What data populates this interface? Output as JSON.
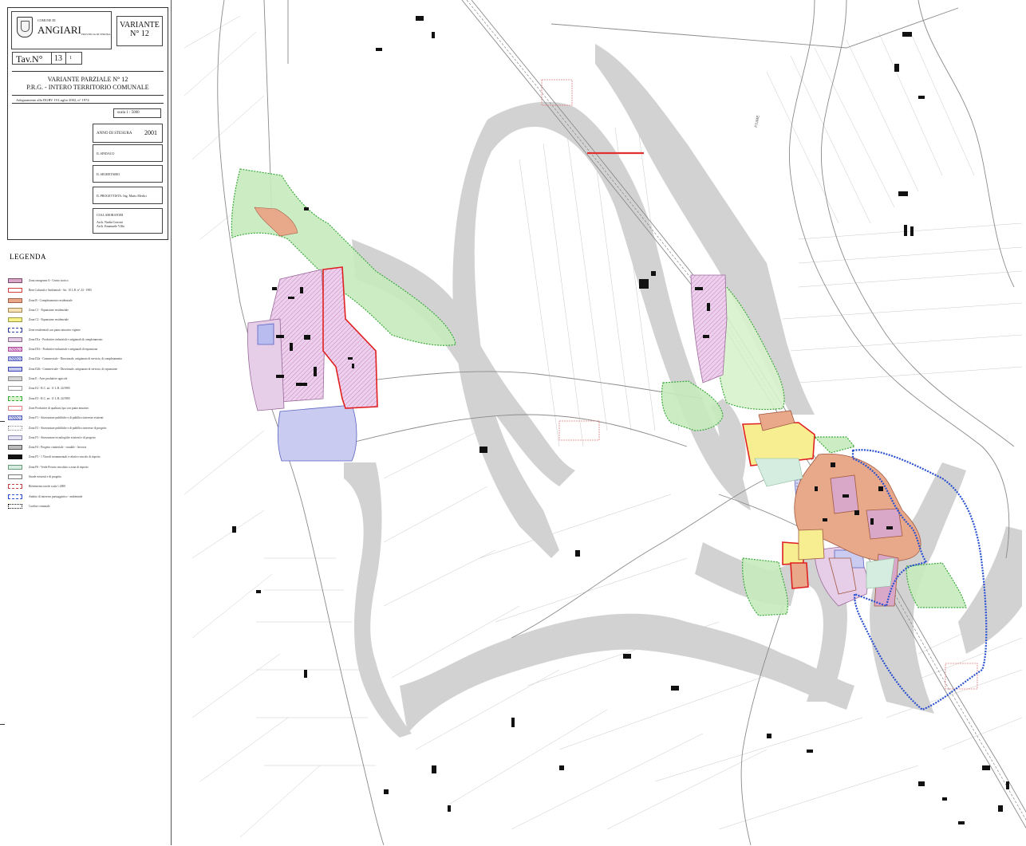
{
  "header": {
    "comune_small": "COMUNE DI",
    "comune_name": "ANGIARI",
    "provincia": "PROVINCIA DI VERONA",
    "variante_line1": "VARIANTE",
    "variante_line2": "N° 12",
    "tav_label": "Tav.N°",
    "tav_number": "13",
    "tav_sub": "1"
  },
  "title_block": {
    "line1": "VARIANTE PARZIALE N° 12",
    "line2": "P.R.G. - INTERO TERRITORIO COMUNALE",
    "line3": "Adeguamento alla DGRV 19 Luglio 2002, n° 1974",
    "scale": "scala 1 : 5000"
  },
  "signatures": {
    "anno_label": "ANNO DI STESURA",
    "anno_value": "2001",
    "sindaco": "IL SINDACO",
    "segretario": "IL SEGRETARIO",
    "progettista": "IL PROGETTISTA: Ing. Mario Medici",
    "collaboratori": "COLLABORATORI",
    "collab1": "Arch. Nadia Cerroni",
    "collab2": "Arch. Emanuele Villa"
  },
  "legend": {
    "title": "LEGENDA",
    "items": [
      {
        "label": "Zona omogenea A - Centro storico",
        "color": "#d9a7c7",
        "border": "#7a4a6a",
        "pattern": "solid"
      },
      {
        "label": "Beni Culturali e Ambientali - Art. 10 L.R. n° 24 - 1985",
        "color": "#ffffff",
        "border": "#d04040",
        "pattern": "solid"
      },
      {
        "label": "Zona B - Completamento residenziale",
        "color": "#eaa88a",
        "border": "#a0604a",
        "pattern": "solid"
      },
      {
        "label": "Zona C1 - Espansione residenziale",
        "color": "#f7e2b6",
        "border": "#a08850",
        "pattern": "solid"
      },
      {
        "label": "Zona C2 - Espansione residenziale",
        "color": "#f7f28a",
        "border": "#999944",
        "pattern": "solid"
      },
      {
        "label": "Zone residenziali con piano attuativo vigente",
        "color": "#ffffff",
        "border": "#2a3a9a",
        "pattern": "dashed"
      },
      {
        "label": "Zona D1a - Produttive industriali e artigianali di completamento",
        "color": "#e6cfe6",
        "border": "#8a6a8a",
        "pattern": "solid"
      },
      {
        "label": "Zona D1b - Produttive industriali e artigianali di espansione",
        "color": "#ecc6e6",
        "border": "#b04a9a",
        "pattern": "hatch"
      },
      {
        "label": "Zona D2a - Commerciale - Direzionale, artigianato di servizio, di completamento",
        "color": "#c9cdf0",
        "border": "#5a64c0",
        "pattern": "hatch"
      },
      {
        "label": "Zona D2b - Commerciale - Direzionale, artigianato di servizio, di espansione",
        "color": "#c6c9ee",
        "border": "#3a44b0",
        "pattern": "solid"
      },
      {
        "label": "Zona E - Aree produttive agricole",
        "color": "#d6d6d6",
        "border": "#888888",
        "pattern": "solid"
      },
      {
        "label": "Zona E2 - R.C. art. 11 L.R. 24/1985",
        "color": "#ffffff",
        "border": "#999999",
        "pattern": "solid"
      },
      {
        "label": "Zona E3 - R.C. art. 11 L.R. 24/1985",
        "color": "#d8f2cc",
        "border": "#3aaa3a",
        "pattern": "dashed"
      },
      {
        "label": "Zone Produttive di qualsiasi tipo con piano attuativo",
        "color": "#ffffff",
        "border": "#e08080",
        "pattern": "solid"
      },
      {
        "label": "Zona F1 - Attrezzature pubbliche e di pubblico interesse esistenti",
        "color": "#d9dcf2",
        "border": "#5a64c0",
        "pattern": "hatch"
      },
      {
        "label": "Zona F2 - Attrezzature pubbliche e di pubblico interesse di progetto",
        "color": "#ffffff",
        "border": "#888888",
        "pattern": "dots"
      },
      {
        "label": "Zona F3 - Attrezzature tecnologiche esistenti e di progetto",
        "color": "#e6e4f4",
        "border": "#8888aa",
        "pattern": "solid"
      },
      {
        "label": "Zona F4 - Progetto cimiteriale - stradale - ferrovia",
        "color": "#bdbdbd",
        "border": "#555555",
        "pattern": "solid"
      },
      {
        "label": "Zona F5 - 1 Vincoli monumentali e relativo vincolo di rispetto",
        "color": "#111111",
        "border": "#111111",
        "pattern": "solid"
      },
      {
        "label": "Zona F6 - Verde Privato vincolato a zona di rispetto",
        "color": "#d5ede0",
        "border": "#6a9a7a",
        "pattern": "solid"
      },
      {
        "label": "Strade esistenti e di progetto",
        "color": "#ffffff",
        "border": "#777777",
        "pattern": "solid"
      },
      {
        "label": "Riferimento tavole scala 1:2000",
        "color": "#ffffff",
        "border": "#c04040",
        "pattern": "dashed"
      },
      {
        "label": "Ambito di interesse paesaggistico - ambientale",
        "color": "#ffffff",
        "border": "#2a50d0",
        "pattern": "dashed"
      },
      {
        "label": "Confine comunale",
        "color": "#ffffff",
        "border": "#111111",
        "pattern": "dots"
      }
    ]
  },
  "map": {
    "place_labels": [
      "FIUME"
    ],
    "colors": {
      "gray_band": "#cfcfcf",
      "green_zone": "#c7ebbe",
      "pink_zone": "#e6cde8",
      "blue_zone": "#c9cbf0",
      "orange_zone": "#e8a88a",
      "yellow_zone": "#f6ee90",
      "red_outline": "#e02020",
      "blue_dotted": "#2a50d0",
      "road": "#8a8a8a"
    }
  }
}
